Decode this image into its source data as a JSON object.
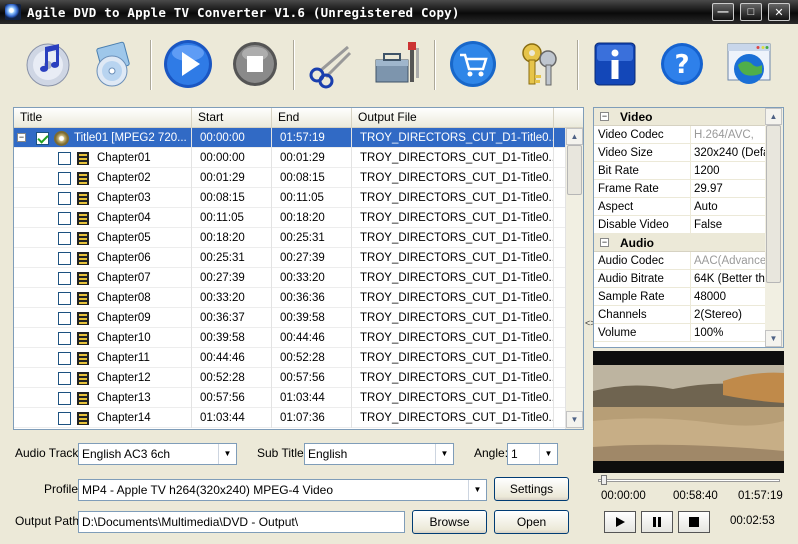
{
  "window": {
    "title": "Agile DVD to Apple TV Converter V1.6 (Unregistered Copy)",
    "controls": [
      "minimize",
      "maximize",
      "close"
    ]
  },
  "toolbar": {
    "items": [
      {
        "icon": "itunes-music-icon"
      },
      {
        "icon": "load-discs-icon"
      },
      {
        "icon": "play-convert-icon"
      },
      {
        "icon": "stop-icon"
      },
      {
        "icon": "scissors-clip-icon"
      },
      {
        "icon": "toolbox-settings-icon"
      },
      {
        "icon": "buy-cart-icon"
      },
      {
        "icon": "register-keys-icon"
      },
      {
        "icon": "info-icon"
      },
      {
        "icon": "help-icon"
      },
      {
        "icon": "website-globe-icon"
      }
    ]
  },
  "list": {
    "headers": {
      "title": "Title",
      "start": "Start",
      "end": "End",
      "output": "Output File"
    },
    "rows": [
      {
        "title": "Title01 [MPEG2 720...",
        "start": "00:00:00",
        "end": "01:57:19",
        "output": "TROY_DIRECTORS_CUT_D1-Title0...",
        "level": 0,
        "checked": true,
        "selected": true
      },
      {
        "title": "Chapter01",
        "start": "00:00:00",
        "end": "00:01:29",
        "output": "TROY_DIRECTORS_CUT_D1-Title0...",
        "level": 1,
        "checked": false
      },
      {
        "title": "Chapter02",
        "start": "00:01:29",
        "end": "00:08:15",
        "output": "TROY_DIRECTORS_CUT_D1-Title0...",
        "level": 1,
        "checked": false
      },
      {
        "title": "Chapter03",
        "start": "00:08:15",
        "end": "00:11:05",
        "output": "TROY_DIRECTORS_CUT_D1-Title0...",
        "level": 1,
        "checked": false
      },
      {
        "title": "Chapter04",
        "start": "00:11:05",
        "end": "00:18:20",
        "output": "TROY_DIRECTORS_CUT_D1-Title0...",
        "level": 1,
        "checked": false
      },
      {
        "title": "Chapter05",
        "start": "00:18:20",
        "end": "00:25:31",
        "output": "TROY_DIRECTORS_CUT_D1-Title0...",
        "level": 1,
        "checked": false
      },
      {
        "title": "Chapter06",
        "start": "00:25:31",
        "end": "00:27:39",
        "output": "TROY_DIRECTORS_CUT_D1-Title0...",
        "level": 1,
        "checked": false
      },
      {
        "title": "Chapter07",
        "start": "00:27:39",
        "end": "00:33:20",
        "output": "TROY_DIRECTORS_CUT_D1-Title0...",
        "level": 1,
        "checked": false
      },
      {
        "title": "Chapter08",
        "start": "00:33:20",
        "end": "00:36:36",
        "output": "TROY_DIRECTORS_CUT_D1-Title0...",
        "level": 1,
        "checked": false
      },
      {
        "title": "Chapter09",
        "start": "00:36:37",
        "end": "00:39:58",
        "output": "TROY_DIRECTORS_CUT_D1-Title0...",
        "level": 1,
        "checked": false
      },
      {
        "title": "Chapter10",
        "start": "00:39:58",
        "end": "00:44:46",
        "output": "TROY_DIRECTORS_CUT_D1-Title0...",
        "level": 1,
        "checked": false
      },
      {
        "title": "Chapter11",
        "start": "00:44:46",
        "end": "00:52:28",
        "output": "TROY_DIRECTORS_CUT_D1-Title0...",
        "level": 1,
        "checked": false
      },
      {
        "title": "Chapter12",
        "start": "00:52:28",
        "end": "00:57:56",
        "output": "TROY_DIRECTORS_CUT_D1-Title0...",
        "level": 1,
        "checked": false
      },
      {
        "title": "Chapter13",
        "start": "00:57:56",
        "end": "01:03:44",
        "output": "TROY_DIRECTORS_CUT_D1-Title0...",
        "level": 1,
        "checked": false
      },
      {
        "title": "Chapter14",
        "start": "01:03:44",
        "end": "01:07:36",
        "output": "TROY_DIRECTORS_CUT_D1-Title0...",
        "level": 1,
        "checked": false
      }
    ]
  },
  "properties": {
    "video_group": "Video",
    "video": [
      {
        "key": "Video Codec",
        "value": "H.264/AVC,",
        "dim": true
      },
      {
        "key": "Video Size",
        "value": "320x240 (Defa",
        "dim": false
      },
      {
        "key": "Bit Rate",
        "value": "1200",
        "dim": false
      },
      {
        "key": "Frame Rate",
        "value": "29.97",
        "dim": false
      },
      {
        "key": "Aspect",
        "value": "Auto",
        "dim": false
      },
      {
        "key": "Disable Video",
        "value": "False",
        "dim": false
      }
    ],
    "audio_group": "Audio",
    "audio": [
      {
        "key": "Audio Codec",
        "value": "AAC(Advance",
        "dim": true
      },
      {
        "key": "Audio Bitrate",
        "value": "64K (Better tha",
        "dim": false
      },
      {
        "key": "Sample Rate",
        "value": "48000",
        "dim": false
      },
      {
        "key": "Channels",
        "value": "2(Stereo)",
        "dim": false
      },
      {
        "key": "Volume",
        "value": "100%",
        "dim": false
      }
    ]
  },
  "player": {
    "time_start": "00:00:00",
    "time_current": "00:58:40",
    "time_end": "01:57:19",
    "elapsed": "00:02:53",
    "seek_fraction": 0.0
  },
  "controls": {
    "audio_track_label": "Audio Track:",
    "audio_track_value": "English AC3 6ch",
    "subtitle_label": "Sub Title:",
    "subtitle_value": "English",
    "angle_label": "Angle:",
    "angle_value": "1",
    "profile_label": "Profile:",
    "profile_value": "MP4 - Apple TV h264(320x240) MPEG-4 Video",
    "settings_button": "Settings",
    "output_label": "Output Path:",
    "output_value": "D:\\Documents\\Multimedia\\DVD - Output\\",
    "browse_button": "Browse",
    "open_button": "Open"
  }
}
